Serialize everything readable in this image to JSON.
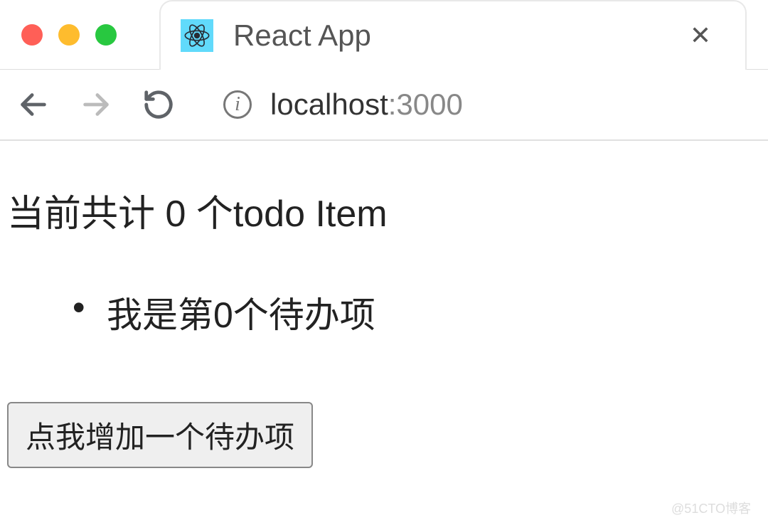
{
  "browser": {
    "tab_title": "React App",
    "url_host": "localhost",
    "url_port": ":3000"
  },
  "page": {
    "heading": "当前共计 0 个todo Item",
    "todo_items": [
      "我是第0个待办项"
    ],
    "add_button_label": "点我增加一个待办项"
  },
  "watermark": "@51CTO博客"
}
